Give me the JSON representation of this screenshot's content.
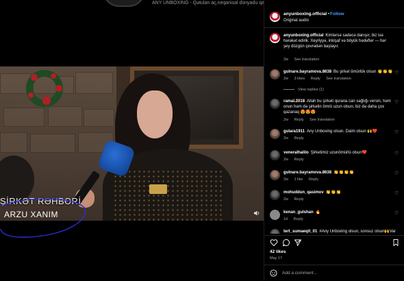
{
  "media": {
    "top_caption": "ANY UNBOXING - Qətulan aç,neqanisal dünyadu qazan",
    "lower_third_title": "ŞİRKƏT RƏHBƏRİ",
    "lower_third_name": "ARZU XANIM"
  },
  "post": {
    "username": "anyunboxing.official",
    "dot": "•",
    "follow_label": "Follow",
    "audio_label": "Original audio",
    "caption_user": "anyunboxing.official",
    "caption_text": "Kimlərsə sadəcə danışır, biz isə hərəkət edirik. Xeyriyyə, inkişaf və böyük hədəflər — hər şey düzgün çevrədən başlayır.",
    "caption_time": "2w",
    "caption_see_translation": "See translation",
    "likes": "42 likes",
    "date": "May 17",
    "add_comment_placeholder": "Add a comment..."
  },
  "comments": [
    {
      "user": "gulnare.bayramova.8638",
      "text": "Bu şirkət ömürlük olsun 👏👏👏",
      "time": "2w",
      "likes": "3 likes",
      "reply": "Reply",
      "see_translation": "See translation",
      "view_replies": "View replies (1)"
    },
    {
      "user": "ramal.2018",
      "text": "Allah bu şirkəti qurana can sağlığı versin, həm onun həm də şirkətin ömrü uzun olsun, biz də daha çox qazanaq 😍😍😍",
      "time": "2w",
      "reply": "Reply",
      "see_translation": "See translation"
    },
    {
      "user": "gulara1911",
      "text": "Any Unboxing olsun, Daim olsun 🙌❤️",
      "time": "2w",
      "reply": "Reply"
    },
    {
      "user": "veneralhalilo",
      "text": "Şirketimiz uzunömürlü olsun❤️",
      "time": "2w",
      "reply": "Reply"
    },
    {
      "user": "gulnare.bayramova.8638",
      "text": "👏👏👏👏",
      "time": "2w",
      "likes": "1 like",
      "reply": "Reply"
    },
    {
      "user": "mohuddun_qasimov",
      "text": "👏👏👏",
      "time": "2w",
      "reply": "Reply"
    },
    {
      "user": "kenan_gulshan",
      "text": "🔥",
      "time": "1d",
      "reply": "Reply"
    },
    {
      "user": "tert_sumaeqit_01",
      "text": "#Any Unboxing olsun, sonsuz olsun🙌Var"
    }
  ],
  "icons": {
    "heart": "heart-icon",
    "comment": "comment-icon",
    "share": "share-icon",
    "save": "bookmark-icon",
    "emoji": "emoji-icon",
    "volume": "volume-icon"
  },
  "colors": {
    "follow": "#4a9eff",
    "brand_red": "#c21b2e"
  }
}
